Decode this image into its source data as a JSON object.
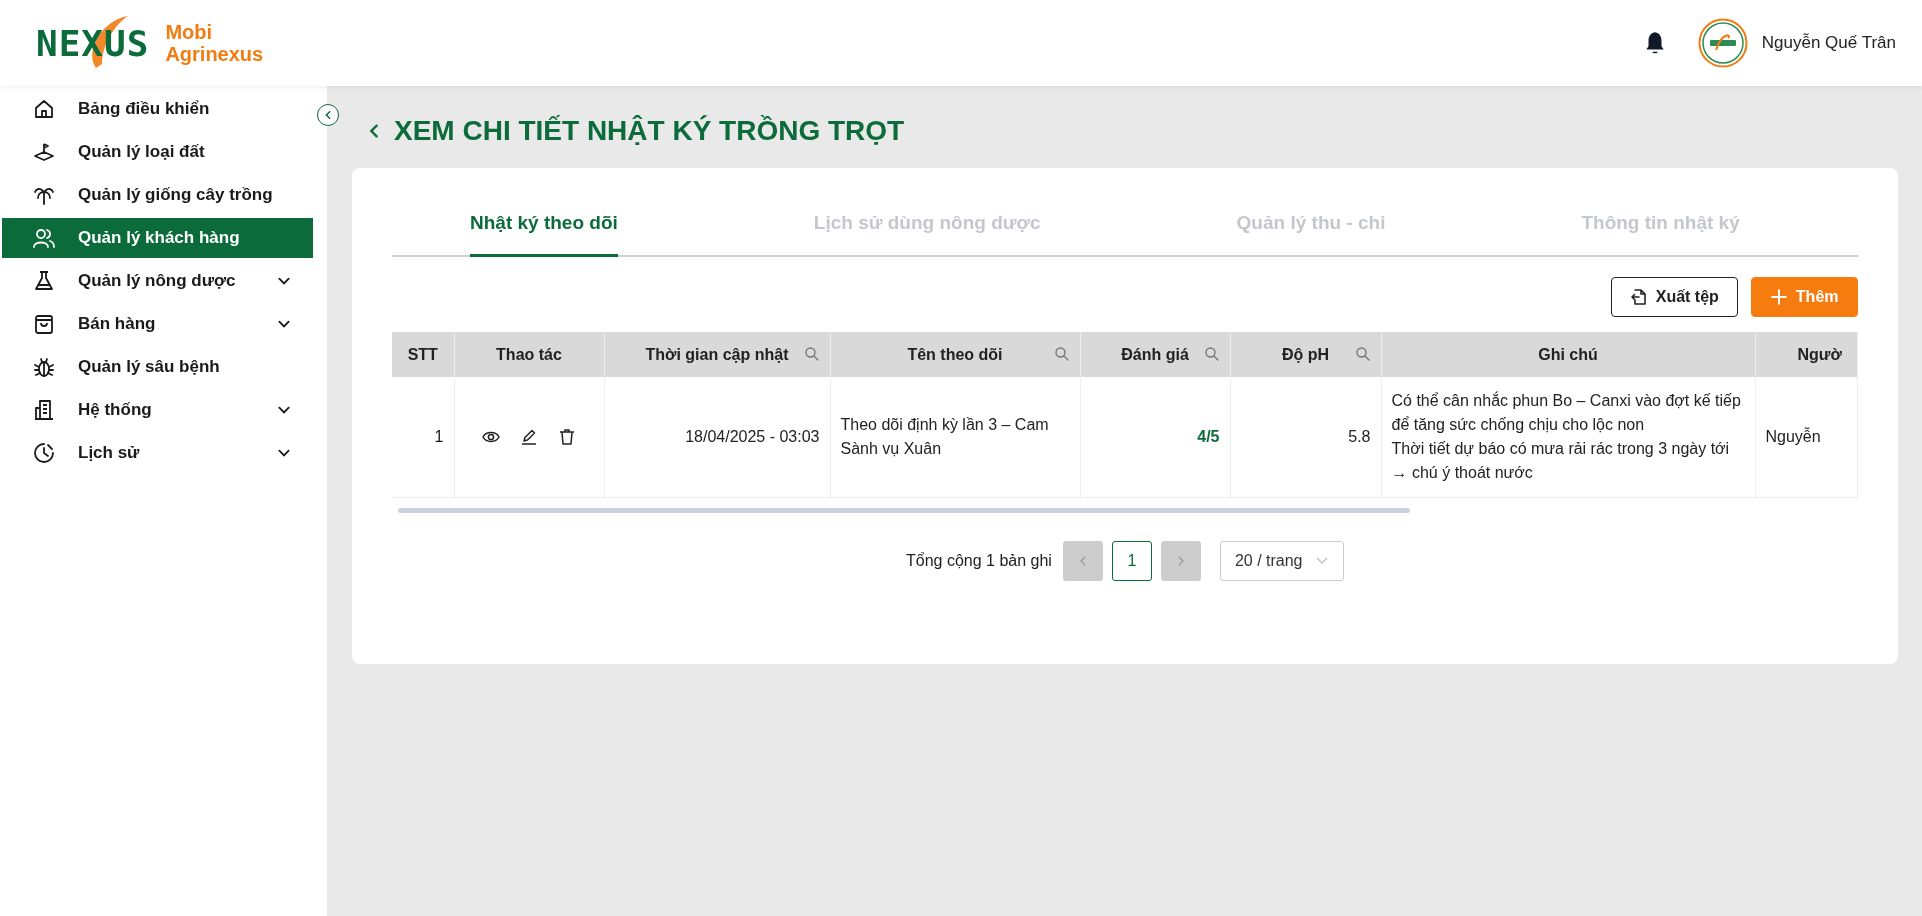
{
  "brand": {
    "logo": "NEXUS",
    "name_line1": "Mobi",
    "name_line2": "Agrinexus"
  },
  "user": {
    "name": "Nguyễn Quế Trân"
  },
  "sidebar": {
    "items": [
      {
        "label": "Bảng điều khiển",
        "kind": "link",
        "selected": false
      },
      {
        "label": "Quản lý loại đất",
        "kind": "link",
        "selected": false
      },
      {
        "label": "Quản lý giống cây trồng",
        "kind": "link",
        "selected": false
      },
      {
        "label": "Quản lý khách hàng",
        "kind": "link",
        "selected": true
      },
      {
        "label": "Quản lý nông dược",
        "kind": "group",
        "selected": false
      },
      {
        "label": "Bán hàng",
        "kind": "group",
        "selected": false
      },
      {
        "label": "Quản lý sâu bệnh",
        "kind": "link",
        "selected": false
      },
      {
        "label": "Hệ thống",
        "kind": "group",
        "selected": false
      },
      {
        "label": "Lịch sử",
        "kind": "group",
        "selected": false
      }
    ]
  },
  "page": {
    "title": "XEM CHI TIẾT NHẬT KÝ TRỒNG TRỌT"
  },
  "tabs": [
    {
      "label": "Nhật ký theo dõi",
      "selected": true
    },
    {
      "label": "Lịch sử dùng nông dược",
      "selected": false
    },
    {
      "label": "Quản lý thu - chi",
      "selected": false
    },
    {
      "label": "Thông tin nhật ký",
      "selected": false
    }
  ],
  "buttons": [
    {
      "label": "Xuất tệp",
      "kind": "export"
    },
    {
      "label": "Thêm",
      "kind": "add"
    }
  ],
  "table": {
    "columns": [
      {
        "label": "STT",
        "kind": "number",
        "searchable": false
      },
      {
        "label": "Thao tác",
        "kind": "actions",
        "searchable": false
      },
      {
        "label": "Thời gian cập nhật",
        "kind": "number",
        "searchable": true
      },
      {
        "label": "Tên theo dõi",
        "kind": "text",
        "searchable": true
      },
      {
        "label": "Đánh giá",
        "kind": "rating",
        "searchable": true
      },
      {
        "label": "Độ pH",
        "kind": "number",
        "searchable": true
      },
      {
        "label": "Ghi chú",
        "kind": "text",
        "searchable": false
      },
      {
        "label": "Ngườ",
        "kind": "text",
        "searchable": false
      }
    ],
    "rows": [
      {
        "cells": [
          "1",
          "",
          "18/04/2025 - 03:03",
          "Theo dõi định kỳ lần 3 – Cam Sành vụ Xuân",
          "4/5",
          "5.8",
          "Có thể cân nhắc phun Bo – Canxi vào đợt kế tiếp để tăng sức chống chịu cho lộc non\nThời tiết dự báo có mưa rải rác trong 3 ngày tới → chú ý thoát nước",
          "Nguyễn"
        ]
      }
    ]
  },
  "pagination": {
    "total": "Tổng cộng 1 bản ghi",
    "prev_disabled": true,
    "next_disabled": true,
    "pages": [
      {
        "label": "1",
        "selected": true
      }
    ],
    "page_size": "20 / trang"
  }
}
